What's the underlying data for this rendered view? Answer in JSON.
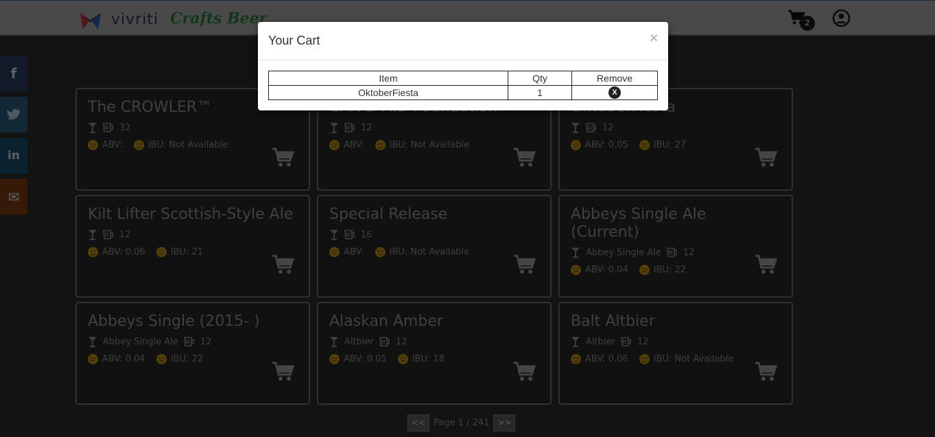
{
  "header": {
    "brand": "vivriti",
    "app_name": "Crafts Beer",
    "cart_count": "2",
    "icons": {
      "cart": "cart-icon",
      "user": "user-icon"
    },
    "colors": {
      "brand": "#2c3450",
      "app_name": "#2e7a3c"
    }
  },
  "social": {
    "facebook": "f",
    "twitter": "t",
    "linkedin": "in",
    "email": "✉"
  },
  "cards": [
    {
      "title": "The CROWLER™",
      "style": "",
      "ounces": "32",
      "abv": "ABV: ",
      "ibu": "IBU: Not Available",
      "abv_mood": "sad",
      "ibu_mood": "happy"
    },
    {
      "title": "CAN'D AID Foundation",
      "style": "",
      "ounces": "12",
      "abv": "ABV: ",
      "ibu": "IBU: Not Available",
      "abv_mood": "sad",
      "ibu_mood": "happy"
    },
    {
      "title": "OktoberFiesta",
      "style": "",
      "ounces": "12",
      "abv": "ABV: 0.05",
      "ibu": "IBU: 27",
      "abv_mood": "sad",
      "ibu_mood": "sad"
    },
    {
      "title": "Kilt Lifter Scottish-Style Ale",
      "style": "",
      "ounces": "12",
      "abv": "ABV: 0.06",
      "ibu": "IBU: 21",
      "abv_mood": "happy",
      "ibu_mood": "sad"
    },
    {
      "title": "Special Release",
      "style": "",
      "ounces": "16",
      "abv": "ABV: ",
      "ibu": "IBU: Not Available",
      "abv_mood": "sad",
      "ibu_mood": "happy"
    },
    {
      "title": "Abbeys Single Ale (Current)",
      "style": "Abbey Single Ale",
      "ounces": "12",
      "abv": "ABV: 0.04",
      "ibu": "IBU: 22",
      "abv_mood": "sad",
      "ibu_mood": "sad"
    },
    {
      "title": "Abbeys Single (2015- )",
      "style": "Abbey Single Ale",
      "ounces": "12",
      "abv": "ABV: 0.04",
      "ibu": "IBU: 22",
      "abv_mood": "sad",
      "ibu_mood": "sad"
    },
    {
      "title": "Alaskan Amber",
      "style": "Altbier",
      "ounces": "12",
      "abv": "ABV: 0.05",
      "ibu": "IBU: 18",
      "abv_mood": "sad",
      "ibu_mood": "sad"
    },
    {
      "title": "Balt Altbier",
      "style": "Altbier",
      "ounces": "12",
      "abv": "ABV: 0.06",
      "ibu": "IBU: Not Available",
      "abv_mood": "happy",
      "ibu_mood": "happy"
    }
  ],
  "pager": {
    "prev": "<<",
    "label": "Page 1 / 241",
    "next": ">>"
  },
  "modal": {
    "title": "Your Cart",
    "close": "×",
    "columns": [
      "Item",
      "Qty",
      "Remove"
    ],
    "rows": [
      {
        "item": "OktoberFiesta",
        "qty": "1",
        "remove": "X"
      }
    ]
  }
}
